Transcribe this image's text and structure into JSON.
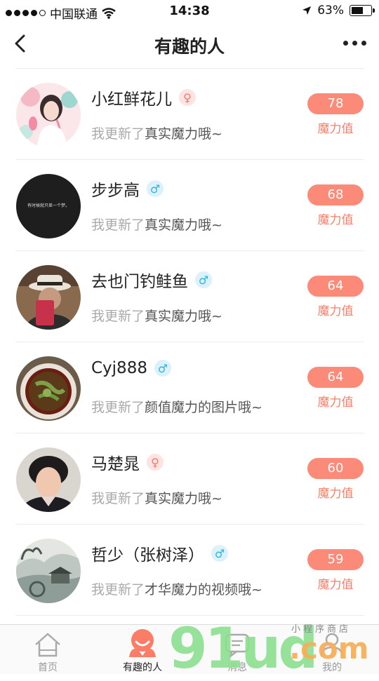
{
  "status_bar": {
    "carrier": "中国联通",
    "time": "14:38",
    "battery": "63%",
    "battery_level": 0.63
  },
  "header": {
    "title": "有趣的人"
  },
  "magic_label": "魔力值",
  "status_prefix": "我更新了",
  "people": [
    {
      "name": "小红鲜花儿",
      "gender": "female",
      "gender_symbol": "♀",
      "update": "真实魔力哦~",
      "score": "78"
    },
    {
      "name": "步步高",
      "gender": "male",
      "gender_symbol": "♂",
      "update": "真实魔力哦~",
      "score": "68",
      "avatar_text": "有时候就只差一个梦。"
    },
    {
      "name": "去也门钓鲑鱼",
      "gender": "male",
      "gender_symbol": "♂",
      "update": "真实魔力哦~",
      "score": "64"
    },
    {
      "name": "Cyj888",
      "gender": "male",
      "gender_symbol": "♂",
      "update": "颜值魔力的图片哦~",
      "score": "64"
    },
    {
      "name": "马楚晁",
      "gender": "female",
      "gender_symbol": "♀",
      "update": "真实魔力哦~",
      "score": "60"
    },
    {
      "name": "哲少（张树泽）",
      "gender": "male",
      "gender_symbol": "♂",
      "update": "才华魔力的视频哦~",
      "score": "59"
    }
  ],
  "tabs": [
    {
      "label": "首页",
      "icon": "home-icon",
      "active": false
    },
    {
      "label": "有趣的人",
      "icon": "people-icon",
      "active": true
    },
    {
      "label": "消息",
      "icon": "message-icon",
      "active": false
    },
    {
      "label": "我的",
      "icon": "profile-icon",
      "active": false
    }
  ],
  "watermark": {
    "logo_number": "91",
    "logo_letters": "ud",
    "logo_suffix": ".com",
    "tagline": "小程序商店"
  },
  "colors": {
    "accent": "#fb8a78",
    "female": "#f47a6a",
    "male": "#2cb3e6"
  }
}
